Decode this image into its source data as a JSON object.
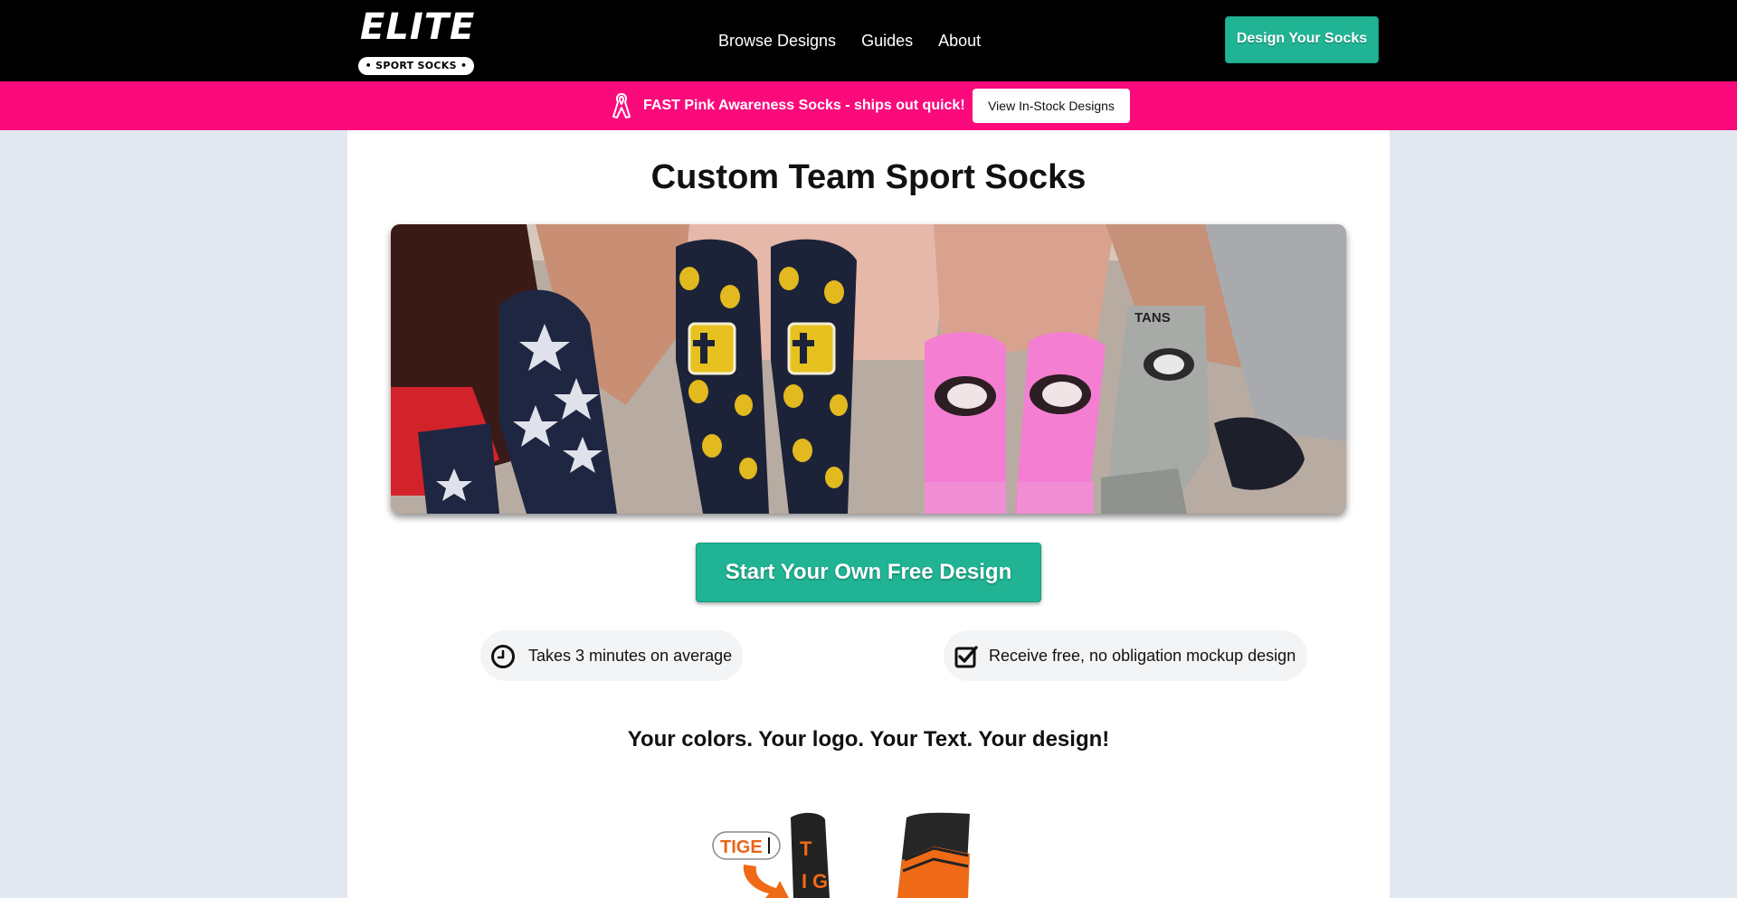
{
  "header": {
    "logo": {
      "word": "ELITE",
      "sub": "• SPORT SOCKS •"
    },
    "nav": [
      {
        "label": "Browse Designs"
      },
      {
        "label": "Guides"
      },
      {
        "label": "About"
      }
    ],
    "cta_label": "Design Your Socks"
  },
  "promo": {
    "icon": "awareness-ribbon-icon",
    "text": "FAST Pink Awareness Socks - ships out quick!",
    "button_label": "View In-Stock Designs",
    "color": "#fb0a7c"
  },
  "main": {
    "title": "Custom Team Sport Socks",
    "cta_label": "Start Your Own Free Design",
    "features": [
      {
        "icon": "clock-icon",
        "text": "Takes 3 minutes on average"
      },
      {
        "icon": "checkbox-checked-icon",
        "text": "Receive free, no obligation mockup design"
      }
    ],
    "tagline": "Your colors. Your logo. Your Text. Your design!",
    "preview_input_text": "TIGE"
  },
  "colors": {
    "header_bg": "#000000",
    "accent_green": "#20b494",
    "page_bg": "#e2e8f0"
  }
}
